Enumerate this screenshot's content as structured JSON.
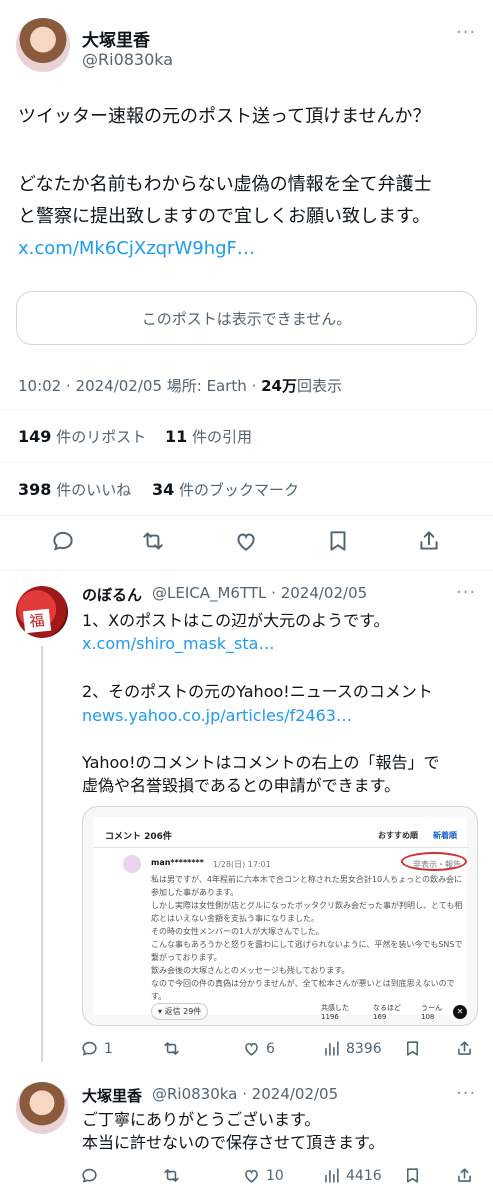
{
  "post": {
    "author_name": "大塚里香",
    "author_handle": "@Ri0830ka",
    "text_lines": [
      "ツイッター速報の元のポスト送って頂けませんか？",
      "どなたか名前もわからない虚偽の情報を全て弁護士",
      "と警察に提出致しますので宜しくお願い致します。"
    ],
    "link": "x.com/Mk6CjXzqrW9hgF…",
    "quote_unavailable": "このポストは表示できません。",
    "time": "10:02 · 2024/02/05 場所: Earth · ",
    "views_count": "24万",
    "views_label": "回表示",
    "reposts_count": "149",
    "reposts_label": "件のリポスト",
    "quotes_count": "11",
    "quotes_label": "件の引用",
    "likes_count": "398",
    "likes_label": "件のいいね",
    "bookmarks_count": "34",
    "bookmarks_label": "件のブックマーク"
  },
  "reply1": {
    "author_name": "のぼるん",
    "author_handle": "@LEICA_M6TTL · 2024/02/05",
    "line1": "1、Xのポストはこの辺が大元のようです。",
    "link1": "x.com/shiro_mask_sta…",
    "line2": "2、そのポストの元のYahoo!ニュースのコメント",
    "link2": "news.yahoo.co.jp/articles/f2463…",
    "line3": "Yahoo!のコメントはコメントの右上の「報告」で",
    "line4": "虚偽や名誉毀損であるとの申請ができます。",
    "avatar_char": "福",
    "replies": "1",
    "likes": "6",
    "views": "8396",
    "embed": {
      "header": "コメント 206件",
      "tab_recommended": "おすすめ順",
      "tab_newest": "新着順",
      "user": "man********",
      "date": "1/28(日) 17:01",
      "report": "非表示・報告",
      "lines": [
        "私は男ですが、4年程前に六本木で合コンと称された男女合計10人ちょっとの飲み会に",
        "参加した事があります。",
        "しかし実際は女性側が店とグルになったボッタクリ飲み会だった事が判明し、とても相",
        "応とはいえない金額を支払う事になりました。",
        "その時の女性メンバーの1人が大塚さんでした。",
        "こんな事もあろうかと怒りを露わにして逃げられないように、平然を装い今でもSNSで",
        "繋がっております。",
        "飲み会後の大塚さんとのメッセージも残しております。",
        "なので今回の件の真偽は分かりませんが、全て松本さんが悪いとは到底思えないので",
        "す。"
      ],
      "replies_btn": "▾ 返信 29件",
      "r1_label": "共感した",
      "r1_count": "1196",
      "r2_label": "なるほど",
      "r2_count": "169",
      "r3_label": "うーん",
      "r3_count": "108"
    }
  },
  "reply2": {
    "author_name": "大塚里香",
    "author_handle": "@Ri0830ka · 2024/02/05",
    "line1": "ご丁寧にありがとうございます。",
    "line2": "本当に許せないので保存させて頂きます。",
    "likes": "10",
    "views": "4416"
  },
  "colors": {
    "link": "#1d9bf0",
    "muted": "#536471",
    "text": "#0f1419",
    "report_circle": "#d0302f"
  }
}
